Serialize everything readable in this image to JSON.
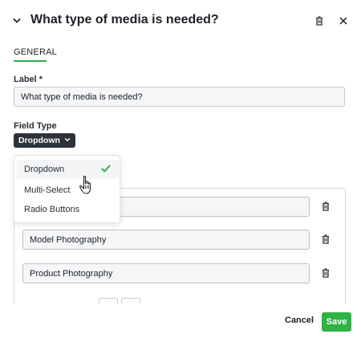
{
  "header": {
    "title": "What type of media is needed?"
  },
  "tabs": [
    {
      "label": "GENERAL"
    }
  ],
  "form": {
    "label_label": "Label *",
    "label_value": "What type of media is needed?",
    "field_type_label": "Field Type",
    "field_type_value": "Dropdown"
  },
  "dropdown_menu": {
    "items": [
      {
        "label": "Dropdown",
        "selected": true
      },
      {
        "label": "Multi-Select",
        "selected": false
      },
      {
        "label": "Radio Buttons",
        "selected": false
      }
    ]
  },
  "options": [
    {
      "value": ""
    },
    {
      "value": "Model Photography"
    },
    {
      "value": "Product Photography"
    }
  ],
  "footer": {
    "cancel_label": "Cancel",
    "save_label": "Save"
  },
  "colors": {
    "accent_green": "#2fb344",
    "tab_underline": "#34a853",
    "field_type_button": "#2d3339"
  }
}
